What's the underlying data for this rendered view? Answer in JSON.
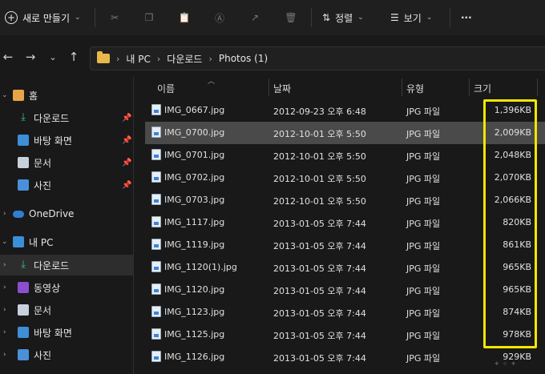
{
  "toolbar": {
    "new_label": "새로 만들기",
    "sort_label": "정렬",
    "view_label": "보기",
    "more_label": "···"
  },
  "breadcrumb": [
    "내 PC",
    "다운로드",
    "Photos (1)"
  ],
  "sidebar": {
    "quick": [
      {
        "label": "홈",
        "icon": "home-icon"
      },
      {
        "label": "다운로드",
        "icon": "download-icon",
        "pinned": true
      },
      {
        "label": "바탕 화면",
        "icon": "desktop-icon",
        "pinned": true
      },
      {
        "label": "문서",
        "icon": "document-icon",
        "pinned": true
      },
      {
        "label": "사진",
        "icon": "picture-icon",
        "pinned": true
      }
    ],
    "onedrive": "OneDrive",
    "thispc": "내 PC",
    "pc_items": [
      {
        "label": "다운로드",
        "icon": "download-icon"
      },
      {
        "label": "동영상",
        "icon": "video-icon"
      },
      {
        "label": "문서",
        "icon": "document-icon"
      },
      {
        "label": "바탕 화면",
        "icon": "desktop-icon"
      },
      {
        "label": "사진",
        "icon": "picture-icon"
      }
    ]
  },
  "columns": {
    "name": "이름",
    "date": "날짜",
    "type": "유형",
    "size": "크기"
  },
  "files": [
    {
      "name": "IMG_0667.jpg",
      "date": "2012-09-23 오후 6:48",
      "type": "JPG 파일",
      "size": "1,396KB"
    },
    {
      "name": "IMG_0700.jpg",
      "date": "2012-10-01 오후 5:50",
      "type": "JPG 파일",
      "size": "2,009KB"
    },
    {
      "name": "IMG_0701.jpg",
      "date": "2012-10-01 오후 5:50",
      "type": "JPG 파일",
      "size": "2,048KB"
    },
    {
      "name": "IMG_0702.jpg",
      "date": "2012-10-01 오후 5:50",
      "type": "JPG 파일",
      "size": "2,070KB"
    },
    {
      "name": "IMG_0703.jpg",
      "date": "2012-10-01 오후 5:50",
      "type": "JPG 파일",
      "size": "2,066KB"
    },
    {
      "name": "IMG_1117.jpg",
      "date": "2013-01-05 오후 7:44",
      "type": "JPG 파일",
      "size": "820KB"
    },
    {
      "name": "IMG_1119.jpg",
      "date": "2013-01-05 오후 7:44",
      "type": "JPG 파일",
      "size": "861KB"
    },
    {
      "name": "IMG_1120(1).jpg",
      "date": "2013-01-05 오후 7:44",
      "type": "JPG 파일",
      "size": "965KB"
    },
    {
      "name": "IMG_1120.jpg",
      "date": "2013-01-05 오후 7:44",
      "type": "JPG 파일",
      "size": "965KB"
    },
    {
      "name": "IMG_1123.jpg",
      "date": "2013-01-05 오후 7:44",
      "type": "JPG 파일",
      "size": "874KB"
    },
    {
      "name": "IMG_1125.jpg",
      "date": "2013-01-05 오후 7:44",
      "type": "JPG 파일",
      "size": "978KB"
    },
    {
      "name": "IMG_1126.jpg",
      "date": "2013-01-05 오후 7:44",
      "type": "JPG 파일",
      "size": "929KB"
    }
  ],
  "selected_index": 1,
  "colors": {
    "highlight": "#f2e600",
    "selection": "#4a4a4a",
    "background": "#191919"
  }
}
